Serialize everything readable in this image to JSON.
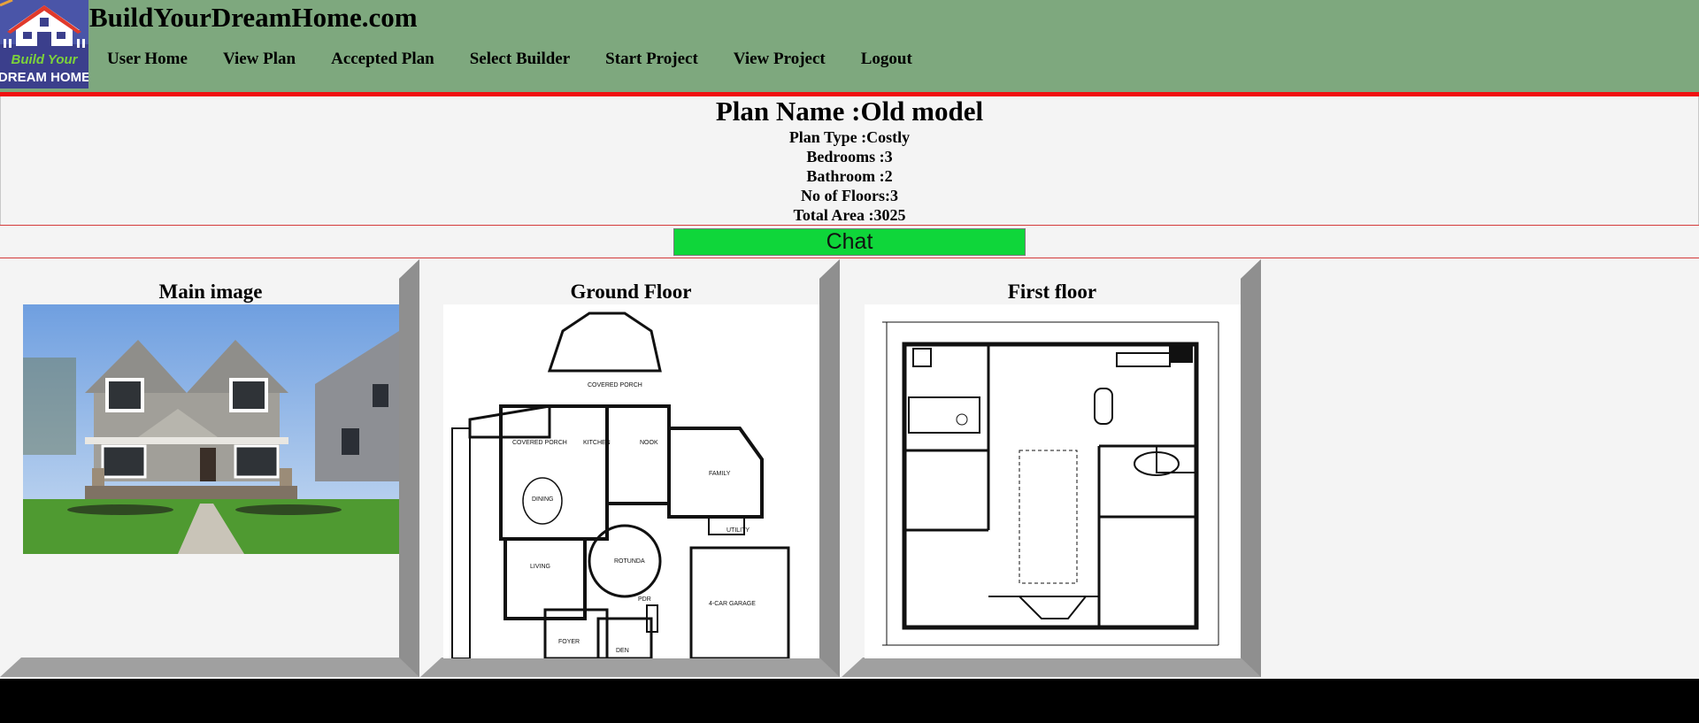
{
  "header": {
    "site_title": "BuildYourDreamHome.com",
    "logo_text_top": "Build Your",
    "logo_text_bottom": "DREAM HOME",
    "nav": [
      {
        "label": "User Home"
      },
      {
        "label": "View Plan"
      },
      {
        "label": "Accepted Plan"
      },
      {
        "label": "Select Builder"
      },
      {
        "label": "Start Project"
      },
      {
        "label": "View Project"
      },
      {
        "label": "Logout"
      }
    ]
  },
  "plan": {
    "name": "Plan Name :Old model",
    "type": "Plan Type :Costly",
    "bedrooms": "Bedrooms :3",
    "bathroom": "Bathroom :2",
    "floors": "No of Floors:3",
    "area": "Total Area :3025"
  },
  "chat_label": "Chat",
  "panels": [
    {
      "title": "Main image"
    },
    {
      "title": "Ground Floor"
    },
    {
      "title": "First floor"
    }
  ],
  "floor_labels": {
    "covered_porch": "COVERED PORCH",
    "kitchen": "KITCHEN",
    "nook": "NOOK",
    "family": "FAMILY",
    "dining": "DINING",
    "rotunda": "ROTUNDA",
    "utility": "UTILITY",
    "living": "LIVING",
    "garage": "4-CAR GARAGE",
    "foyer": "FOYER",
    "den": "DEN",
    "pdr": "PDR"
  },
  "colors": {
    "header_bg": "#7ea87e",
    "accent_red": "#f01010",
    "chat_green": "#0fd63a",
    "panel_shadow": "#a0a0a0",
    "footer": "#000000"
  }
}
